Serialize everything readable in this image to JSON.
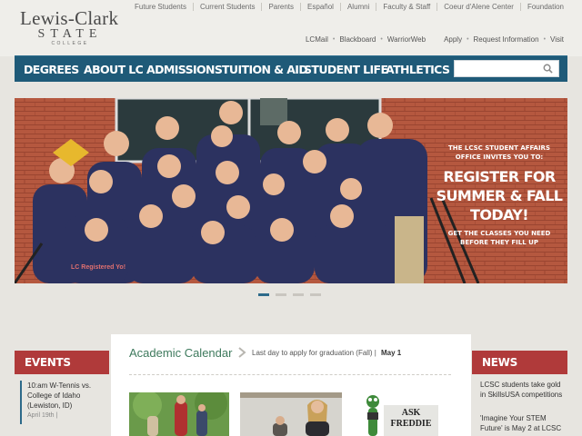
{
  "logo": {
    "line1": "Lewis-Clark",
    "line2": "STATE",
    "line3": "COLLEGE"
  },
  "utility_nav": [
    "Future Students",
    "Current Students",
    "Parents",
    "Español",
    "Alumni",
    "Faculty & Staff",
    "Coeur d'Alene Center",
    "Foundation"
  ],
  "secondary_nav": {
    "links_left": [
      "LCMail",
      "Blackboard",
      "WarriorWeb"
    ],
    "links_right": [
      "Apply",
      "Request Information",
      "Visit"
    ]
  },
  "main_nav": [
    "DEGREES",
    "ABOUT LC",
    "ADMISSIONS",
    "TUITION & AID",
    "STUDENT LIFE",
    "ATHLETICS"
  ],
  "search": {
    "placeholder": ""
  },
  "hero": {
    "line1": "THE LCSC STUDENT AFFAIRS",
    "line2": "OFFICE INVITES YOU TO:",
    "headline1": "REGISTER FOR",
    "headline2": "SUMMER & FALL",
    "headline3": "TODAY!",
    "sub1": "GET THE CLASSES YOU NEED",
    "sub2": "BEFORE THEY FILL UP",
    "shirt_text": "LC Registered Yo!"
  },
  "slider": {
    "count": 4,
    "active": 0
  },
  "events": {
    "heading": "EVENTS",
    "items": [
      {
        "title": "10:am W-Tennis vs. College of Idaho (Lewiston, ID)",
        "date": "April 19th |"
      }
    ]
  },
  "calendar": {
    "title": "Academic Calendar",
    "text": "Last day to apply for graduation (Fall) |",
    "date": "May 1"
  },
  "ask_freddie": {
    "line1": "ASK",
    "line2": "FREDDIE"
  },
  "news": {
    "heading": "NEWS",
    "items": [
      "LCSC students take gold in SkillsUSA competitions",
      "'Imagine Your STEM Future' is May 2 at LCSC"
    ]
  },
  "colors": {
    "nav": "#1f5a78",
    "accent_red": "#b03a3a",
    "calendar_green": "#3e7a5d",
    "slider_active": "#2d6a8a"
  }
}
